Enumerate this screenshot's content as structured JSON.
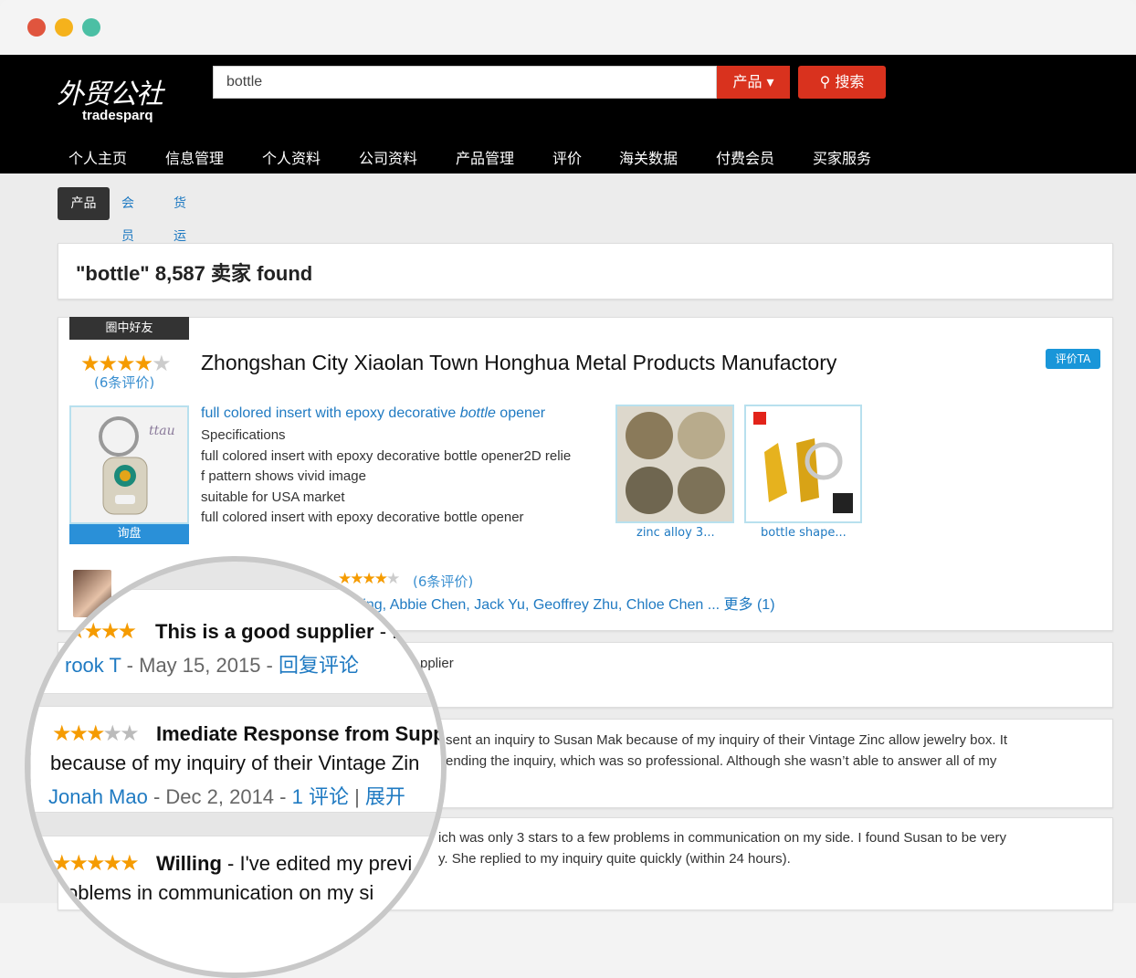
{
  "window": {
    "dots": [
      "#e0553e",
      "#f5b21c",
      "#4bbfa4"
    ]
  },
  "brand": {
    "logo_cn": "外贸公社",
    "logo_en": "tradesparq"
  },
  "search": {
    "value": "bottle",
    "type_label": "产品 ▾",
    "button_label": "搜索"
  },
  "nav": {
    "items": [
      "个人主页",
      "信息管理",
      "个人资料",
      "公司资料",
      "产品管理",
      "评价",
      "海关数据",
      "付费会员",
      "买家服务"
    ]
  },
  "subtabs": [
    "产品",
    "会员",
    "货运"
  ],
  "results": {
    "title": "\"bottle\" 8,587 卖家 found"
  },
  "company": {
    "badge": "圈中好友",
    "name": "Zhongshan City Xiaolan Town Honghua Metal Products Manufactory",
    "rating": 4.5,
    "rating_count": "(6条评价)",
    "rate_button": "评价TA",
    "inquire": "询盘"
  },
  "product": {
    "title_prefix": "full colored insert with epoxy decorative ",
    "title_keyword": "bottle",
    "title_suffix": " opener",
    "lines": [
      "Specifications",
      "full colored insert with epoxy decorative bottle opener2D relie",
      "f pattern shows vivid image",
      "suitable for USA market",
      "full colored insert with epoxy decorative  bottle opener"
    ]
  },
  "related": [
    {
      "label": "zinc alloy 3..."
    },
    {
      "label": "bottle shape..."
    }
  ],
  "people": {
    "rating_count": "(6条评价)",
    "contacts": "ry Ning, Abbie Chen, Jack Yu, Geoffrey Zhu, Chloe Chen ... 更多 (1)"
  },
  "reviews_bg": [
    {
      "text": "pplier"
    },
    {
      "line1": "sent an inquiry to Susan Mak because of my inquiry of their Vintage Zinc allow jewelry box. It",
      "line2": "ending the inquiry, which was so professional. Although she wasn’t able to answer all of my"
    },
    {
      "line1": "ich was only 3 stars to a few problems in communication on my side. I found Susan to be very",
      "line2": "y. She replied to my inquiry quite quickly (within 24 hours)."
    }
  ],
  "magnified": {
    "r1": {
      "stars": 5,
      "title": "This is a good supplier",
      "dash": " - ",
      "trail": "I",
      "author": "rook T",
      "date": " - May 15, 2015 - ",
      "reply": "回复评论"
    },
    "r2": {
      "stars": 3,
      "title": "Imediate Response from Supp",
      "body": "because of my inquiry of their Vintage Zin",
      "author": "Jonah Mao",
      "date": " - Dec 2, 2014 - ",
      "comments": "1 评论",
      "sep": " | ",
      "expand": "展开"
    },
    "r3": {
      "stars": 5,
      "title": "Willing",
      "body": " - I've edited my previ",
      "line2": "oblems in communication on my si"
    }
  }
}
